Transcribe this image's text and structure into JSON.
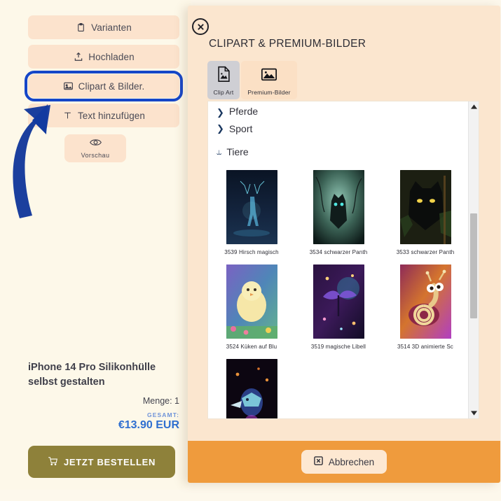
{
  "left_panel": {
    "tools": [
      {
        "label": "Varianten",
        "icon": "clipboard-icon"
      },
      {
        "label": "Hochladen",
        "icon": "upload-icon"
      },
      {
        "label": "Clipart & Bilder.",
        "icon": "image-icon",
        "selected": true
      },
      {
        "label": "Text hinzufügen",
        "icon": "text-icon"
      }
    ],
    "preview": {
      "label": "Vorschau",
      "icon": "eye-icon"
    },
    "product": {
      "title": "iPhone 14 Pro Silikonhülle selbst gestalten",
      "quantity_label": "Menge: 1",
      "total_label": "GESAMT:",
      "total_value": "€13.90 EUR"
    },
    "order_button": {
      "label": "JETZT BESTELLEN",
      "icon": "cart-icon"
    }
  },
  "modal": {
    "close_icon": "close-circle-icon",
    "title": "CLIPART & PREMIUM-BILDER",
    "tabs": [
      {
        "label": "Clip Art",
        "icon": "clipart-file-icon",
        "active": true
      },
      {
        "label": "Premium-Bilder",
        "icon": "photo-icon",
        "active": false
      }
    ],
    "categories": [
      {
        "label": "Pferde",
        "expanded": false,
        "chevron": "chevron-right-icon"
      },
      {
        "label": "Sport",
        "expanded": false,
        "chevron": "chevron-right-icon"
      },
      {
        "label": "Tiere",
        "expanded": true,
        "chevron": "chevron-down-icon"
      }
    ],
    "items": [
      {
        "label": "3539 Hirsch magisch"
      },
      {
        "label": "3534 schwarzer Panth"
      },
      {
        "label": "3533 schwarzer Panth"
      },
      {
        "label": "3524 Küken auf Blu"
      },
      {
        "label": "3519 magische Libell"
      },
      {
        "label": "3514 3D animierte Sc"
      },
      {
        "label": ""
      }
    ],
    "scrollbar": {
      "up_icon": "triangle-up-icon",
      "down_icon": "triangle-down-icon"
    },
    "footer": {
      "cancel_label": "Abbrechen",
      "cancel_icon": "close-box-icon"
    }
  },
  "annotation": {
    "arrow": "curved-arrow-up-right",
    "color": "#1b3f9e"
  },
  "colors": {
    "modal_bg": "#fbe6cf",
    "footer": "#ef9b3d",
    "highlight_ring": "#1546c8",
    "order_button": "#8e813a",
    "price": "#2f6fd0"
  }
}
